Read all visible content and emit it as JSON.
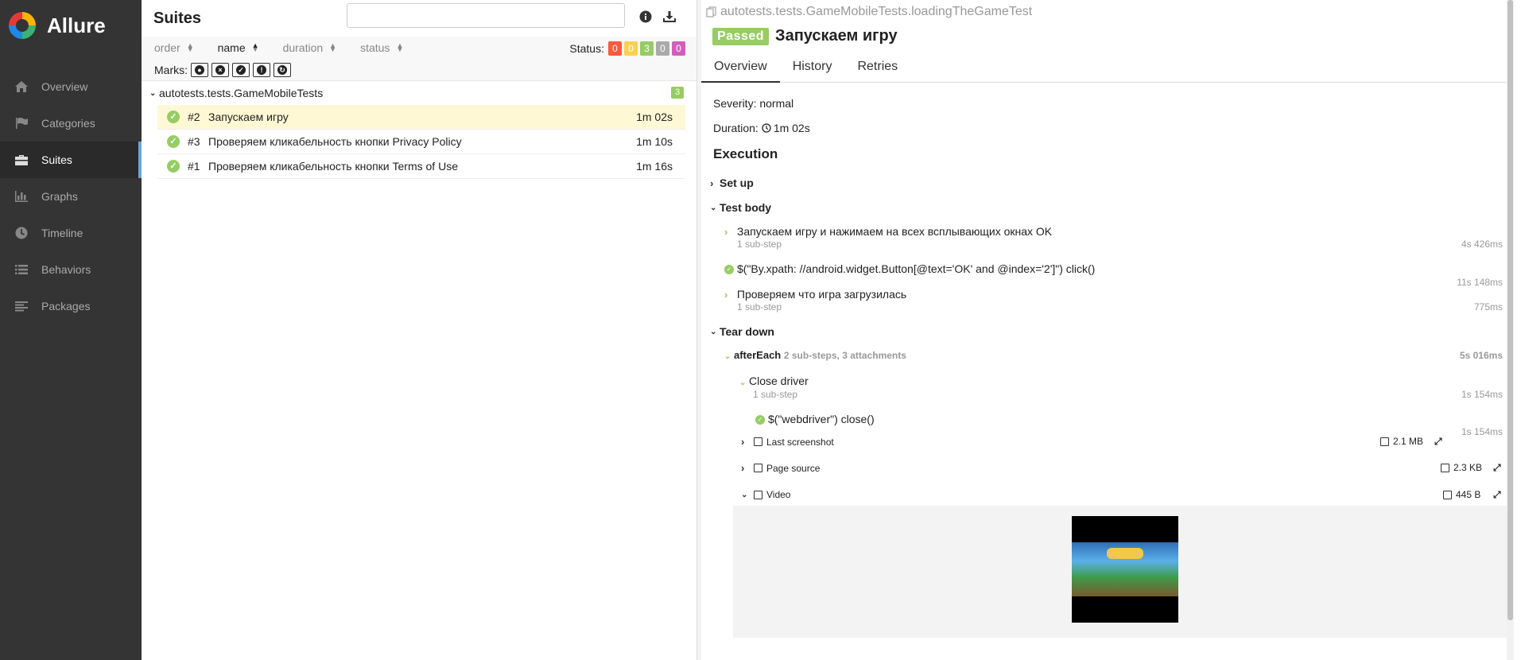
{
  "app": {
    "name": "Allure"
  },
  "sidebar": {
    "items": [
      {
        "label": "Overview",
        "icon": "home-icon"
      },
      {
        "label": "Categories",
        "icon": "flag-icon"
      },
      {
        "label": "Suites",
        "icon": "briefcase-icon",
        "active": true
      },
      {
        "label": "Graphs",
        "icon": "bar-chart-icon"
      },
      {
        "label": "Timeline",
        "icon": "clock-icon"
      },
      {
        "label": "Behaviors",
        "icon": "list-icon"
      },
      {
        "label": "Packages",
        "icon": "align-left-icon"
      }
    ]
  },
  "suites": {
    "title": "Suites",
    "search": {
      "value": "",
      "placeholder": ""
    },
    "sort": {
      "order": "order",
      "name": "name",
      "duration": "duration",
      "status": "status"
    },
    "status_label": "Status:",
    "status_counts": [
      {
        "value": "0",
        "color": "#fd5a3e"
      },
      {
        "value": "0",
        "color": "#ffd050"
      },
      {
        "value": "3",
        "color": "#97cc64"
      },
      {
        "value": "0",
        "color": "#aaaaaa"
      },
      {
        "value": "0",
        "color": "#d35ebe"
      }
    ],
    "marks_label": "Marks:",
    "group": {
      "name": "autotests.tests.GameMobileTests",
      "count": "3"
    },
    "tests": [
      {
        "num": "#2",
        "name": "Запускаем игру",
        "duration": "1m 02s",
        "selected": true
      },
      {
        "num": "#3",
        "name": "Проверяем кликабельность кнопки Privacy Policy",
        "duration": "1m 10s"
      },
      {
        "num": "#1",
        "name": "Проверяем кликабельность кнопки Terms of Use",
        "duration": "1m 16s"
      }
    ]
  },
  "detail": {
    "path": "autotests.tests.GameMobileTests.loadingTheGameTest",
    "status": "Passed",
    "title": "Запускаем игру",
    "tabs": [
      "Overview",
      "History",
      "Retries"
    ],
    "severity": "Severity: normal",
    "duration_label": "Duration:",
    "duration_value": "1m 02s",
    "execution": "Execution",
    "setup": "Set up",
    "test_body": "Test body",
    "steps": [
      {
        "name": "Запускаем игру и нажимаем на всех всплывающих окнах OK",
        "sub": "1 sub-step",
        "duration": "4s 426ms"
      },
      {
        "name": "$(\"By.xpath: //android.widget.Button[@text='OK' and @index='2']\") click()",
        "duration": "11s 148ms"
      },
      {
        "name": "Проверяем что игра загрузилась",
        "sub": "1 sub-step",
        "duration": "775ms"
      }
    ],
    "teardown": "Tear down",
    "after_each": {
      "name": "afterEach",
      "meta": "2 sub-steps, 3 attachments",
      "duration": "5s 016ms"
    },
    "close_driver": {
      "name": "Close driver",
      "sub": "1 sub-step",
      "duration": "1s 154ms"
    },
    "webdriver_close": {
      "name": "$(\"webdriver\") close()",
      "duration": "1s 154ms"
    },
    "attachments": [
      {
        "name": "Last screenshot",
        "size": "2.1 MB"
      },
      {
        "name": "Page source",
        "size": "2.3 KB"
      },
      {
        "name": "Video",
        "size": "445 B"
      }
    ]
  }
}
